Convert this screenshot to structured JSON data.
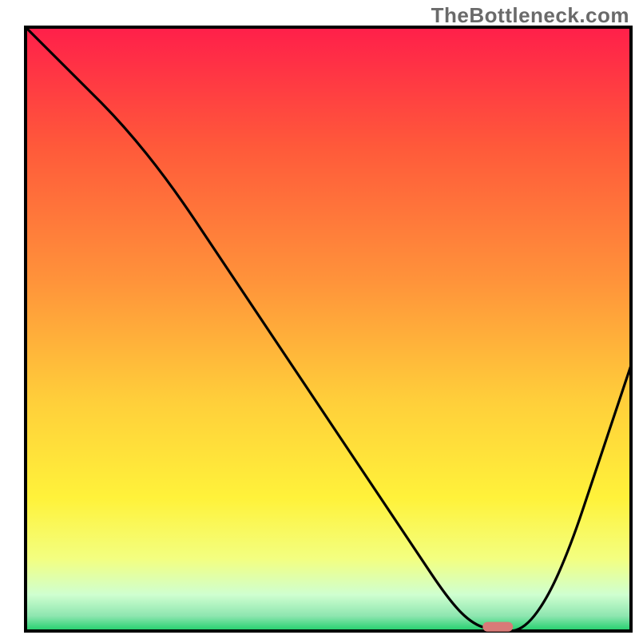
{
  "watermark": "TheBottleneck.com",
  "chart_data": {
    "type": "line",
    "title": "",
    "xlabel": "",
    "ylabel": "",
    "xlim": [
      0,
      100
    ],
    "ylim": [
      0,
      100
    ],
    "grid": false,
    "legend": false,
    "series": [
      {
        "name": "bottleneck-curve",
        "x": [
          0,
          8,
          16,
          24,
          32,
          40,
          48,
          56,
          64,
          70,
          74,
          78,
          82,
          86,
          90,
          94,
          98,
          100
        ],
        "y": [
          100,
          92,
          84,
          74,
          62,
          50,
          38,
          26,
          14,
          5,
          1,
          0,
          0,
          5,
          14,
          26,
          38,
          44
        ]
      }
    ],
    "marker": {
      "name": "optimal-point",
      "x": 78,
      "y": 0.7,
      "width": 5,
      "height": 1.6,
      "color": "#d97a78"
    },
    "background_gradient": {
      "stops": [
        {
          "offset": 0.0,
          "color": "#ff1f4a"
        },
        {
          "offset": 0.2,
          "color": "#ff5a3a"
        },
        {
          "offset": 0.42,
          "color": "#ff933a"
        },
        {
          "offset": 0.62,
          "color": "#ffcf3a"
        },
        {
          "offset": 0.78,
          "color": "#fff23a"
        },
        {
          "offset": 0.88,
          "color": "#f3ff80"
        },
        {
          "offset": 0.94,
          "color": "#cfffd0"
        },
        {
          "offset": 0.975,
          "color": "#8ee6b0"
        },
        {
          "offset": 1.0,
          "color": "#1ecf6a"
        }
      ]
    },
    "frame": {
      "stroke": "#000000",
      "stroke_width": 4
    },
    "line_style": {
      "stroke": "#000000",
      "stroke_width": 3.2
    }
  }
}
